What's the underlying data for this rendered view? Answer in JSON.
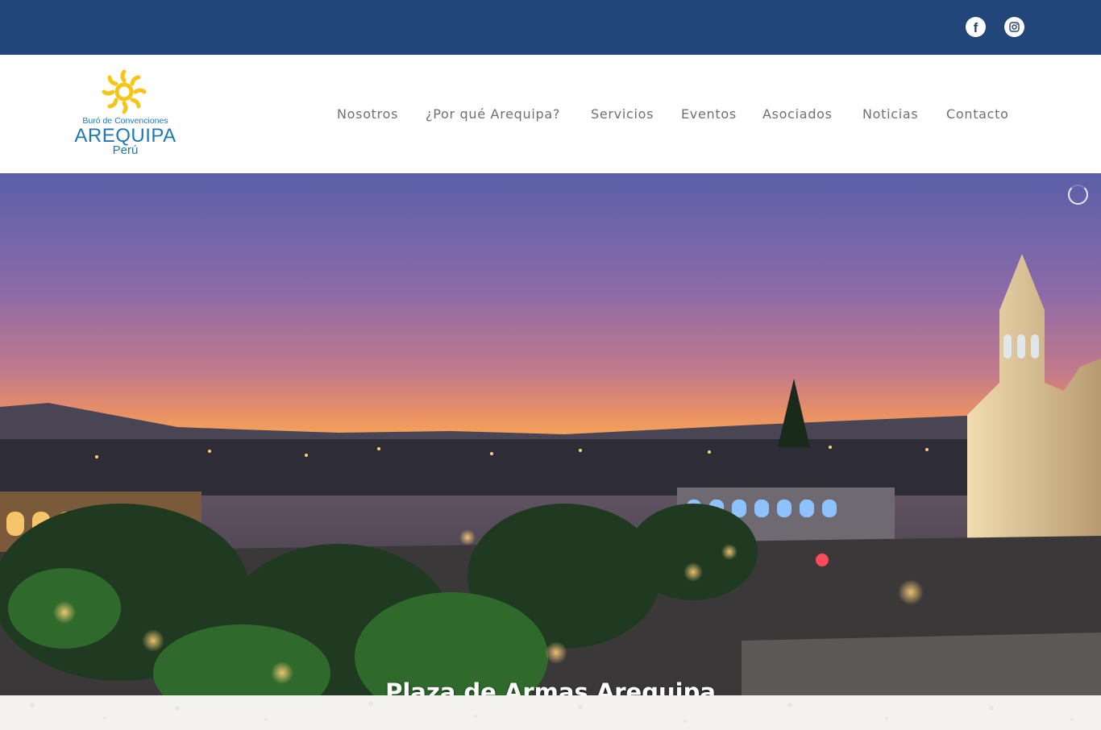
{
  "topbar": {
    "social": [
      {
        "icon": "facebook-icon",
        "label": "f"
      },
      {
        "icon": "instagram-icon"
      }
    ]
  },
  "logo": {
    "small": "Buró de Convenciones",
    "main": "AREQUIPA",
    "sub": "Perú",
    "sun_color": "#f5c518",
    "text_color": "#1f78b4"
  },
  "nav": {
    "items": [
      {
        "label": "Nosotros"
      },
      {
        "label": "¿Por qué Arequipa?"
      },
      {
        "label": "Servicios"
      },
      {
        "label": "Eventos"
      },
      {
        "label": "Asociados"
      },
      {
        "label": "Noticias"
      },
      {
        "label": "Contacto"
      }
    ]
  },
  "hero": {
    "caption": "Plaza de Armas Arequipa"
  },
  "colors": {
    "topbar": "#22467a",
    "nav_text": "#6b7079"
  }
}
